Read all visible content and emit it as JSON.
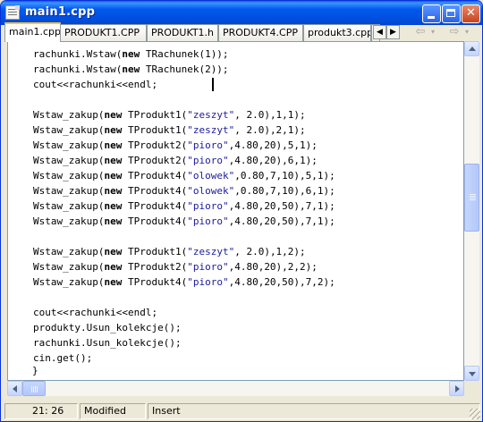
{
  "window": {
    "title": "main1.cpp"
  },
  "tabs": [
    {
      "label": "main1.cpp",
      "active": true
    },
    {
      "label": "PRODUKT1.CPP",
      "active": false
    },
    {
      "label": "PRODUKT1.h",
      "active": false
    },
    {
      "label": "PRODUKT4.CPP",
      "active": false
    },
    {
      "label": "produkt3.cpp",
      "active": false
    }
  ],
  "toolbar_icons": [
    "scroll-left-icon",
    "scroll-right-icon",
    "back-arrow-icon",
    "back-dropdown-icon",
    "forward-arrow-icon",
    "forward-dropdown-icon"
  ],
  "code_lines": [
    [
      {
        "t": "rachunki.Wstaw("
      },
      {
        "k": "new"
      },
      {
        "t": " TRachunek(1));"
      }
    ],
    [
      {
        "t": "rachunki.Wstaw("
      },
      {
        "k": "new"
      },
      {
        "t": " TRachunek(2));"
      }
    ],
    [
      {
        "t": "cout<<rachunki<<endl;"
      }
    ],
    [],
    [
      {
        "t": "Wstaw_zakup("
      },
      {
        "k": "new"
      },
      {
        "t": " TProdukt1("
      },
      {
        "s": "\"zeszyt\""
      },
      {
        "t": ", 2.0),1,1);"
      }
    ],
    [
      {
        "t": "Wstaw_zakup("
      },
      {
        "k": "new"
      },
      {
        "t": " TProdukt1("
      },
      {
        "s": "\"zeszyt\""
      },
      {
        "t": ", 2.0),2,1);"
      }
    ],
    [
      {
        "t": "Wstaw_zakup("
      },
      {
        "k": "new"
      },
      {
        "t": " TProdukt2("
      },
      {
        "s": "\"pioro\""
      },
      {
        "t": ",4.80,20),5,1);"
      }
    ],
    [
      {
        "t": "Wstaw_zakup("
      },
      {
        "k": "new"
      },
      {
        "t": " TProdukt2("
      },
      {
        "s": "\"pioro\""
      },
      {
        "t": ",4.80,20),6,1);"
      }
    ],
    [
      {
        "t": "Wstaw_zakup("
      },
      {
        "k": "new"
      },
      {
        "t": " TProdukt4("
      },
      {
        "s": "\"olowek\""
      },
      {
        "t": ",0.80,7,10),5,1);"
      }
    ],
    [
      {
        "t": "Wstaw_zakup("
      },
      {
        "k": "new"
      },
      {
        "t": " TProdukt4("
      },
      {
        "s": "\"olowek\""
      },
      {
        "t": ",0.80,7,10),6,1);"
      }
    ],
    [
      {
        "t": "Wstaw_zakup("
      },
      {
        "k": "new"
      },
      {
        "t": " TProdukt4("
      },
      {
        "s": "\"pioro\""
      },
      {
        "t": ",4.80,20,50),7,1);"
      }
    ],
    [
      {
        "t": "Wstaw_zakup("
      },
      {
        "k": "new"
      },
      {
        "t": " TProdukt4("
      },
      {
        "s": "\"pioro\""
      },
      {
        "t": ",4.80,20,50),7,1);"
      }
    ],
    [],
    [
      {
        "t": "Wstaw_zakup("
      },
      {
        "k": "new"
      },
      {
        "t": " TProdukt1("
      },
      {
        "s": "\"zeszyt\""
      },
      {
        "t": ", 2.0),1,2);"
      }
    ],
    [
      {
        "t": "Wstaw_zakup("
      },
      {
        "k": "new"
      },
      {
        "t": " TProdukt2("
      },
      {
        "s": "\"pioro\""
      },
      {
        "t": ",4.80,20),2,2);"
      }
    ],
    [
      {
        "t": "Wstaw_zakup("
      },
      {
        "k": "new"
      },
      {
        "t": " TProdukt4("
      },
      {
        "s": "\"pioro\""
      },
      {
        "t": ",4.80,20,50),7,2);"
      }
    ],
    [],
    [
      {
        "t": "cout<<rachunki<<endl;"
      }
    ],
    [
      {
        "t": "produkty.Usun_kolekcje();"
      }
    ],
    [
      {
        "t": "rachunki.Usun_kolekcje();"
      }
    ],
    [
      {
        "t": "cin.get();"
      }
    ]
  ],
  "closing_brace": "}",
  "status": {
    "position": "21:  26",
    "modified": "Modified",
    "mode": "Insert"
  },
  "colors": {
    "title_bar": "#0058ee",
    "string_literal": "#1b1b9e",
    "active_tab_accent": "#ffc83c"
  }
}
